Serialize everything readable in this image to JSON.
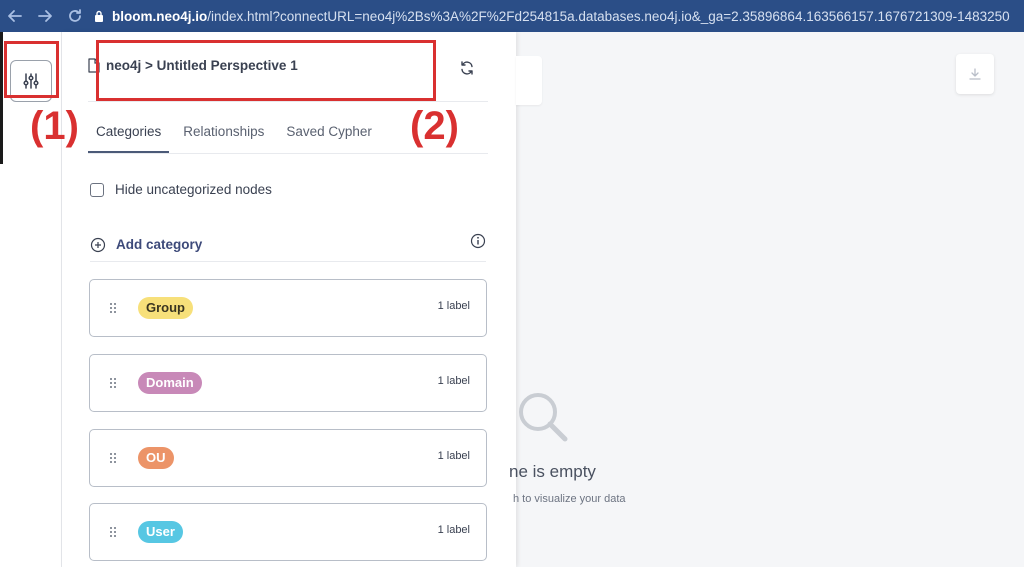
{
  "browser": {
    "url_domain": "bloom.neo4j.io",
    "url_path": "/index.html?connectURL=neo4j%2Bs%3A%2F%2Fd254815a.databases.neo4j.io&_ga=2.35896864.163566157.1676721309-1483250"
  },
  "annotations": {
    "marker_1": "(1)",
    "marker_2": "(2)",
    "color": "#d93030"
  },
  "panel": {
    "breadcrumb": "neo4j > Untitled Perspective 1",
    "tabs": [
      {
        "label": "Categories",
        "active": true
      },
      {
        "label": "Relationships",
        "active": false
      },
      {
        "label": "Saved Cypher",
        "active": false
      }
    ],
    "hide_uncategorized_label": "Hide uncategorized nodes",
    "add_category_label": "Add category",
    "categories": [
      {
        "name": "Group",
        "count": "1 label",
        "color": "#f7e07a",
        "text_color": "#3a3520"
      },
      {
        "name": "Domain",
        "count": "1 label",
        "color": "#c889b8",
        "text_color": "#ffffff"
      },
      {
        "name": "OU",
        "count": "1 label",
        "color": "#ec9468",
        "text_color": "#ffffff"
      },
      {
        "name": "User",
        "count": "1 label",
        "color": "#57c7e3",
        "text_color": "#ffffff"
      }
    ]
  },
  "canvas": {
    "empty_title": "ne is empty",
    "empty_subtitle": "h to visualize your data"
  }
}
